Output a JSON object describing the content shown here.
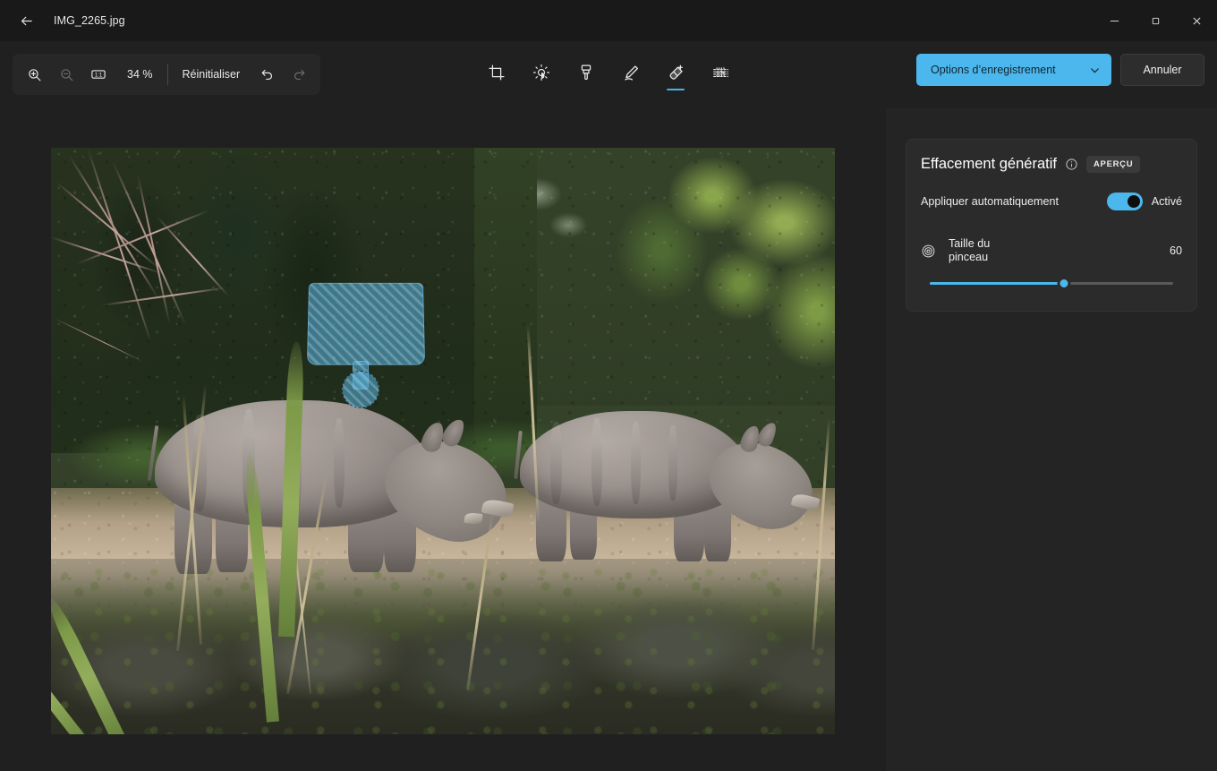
{
  "window": {
    "title": "IMG_2265.jpg",
    "back_icon": "arrow-left-icon",
    "minimize_icon": "minimize-icon",
    "maximize_icon": "maximize-icon",
    "close_icon": "close-icon"
  },
  "toolbar": {
    "zoom_in_icon": "zoom-in-icon",
    "zoom_out_icon": "zoom-out-icon",
    "actual_size_icon": "one-to-one-icon",
    "zoom_level": "34 %",
    "reset_label": "Réinitialiser",
    "undo_icon": "undo-icon",
    "redo_icon": "redo-icon",
    "tools": [
      {
        "name": "crop-tool",
        "icon": "crop-icon",
        "active": false
      },
      {
        "name": "adjustment-tool",
        "icon": "brightness-icon",
        "active": false
      },
      {
        "name": "filter-tool",
        "icon": "paintbrush-icon",
        "active": false
      },
      {
        "name": "markup-tool",
        "icon": "pen-icon",
        "active": false
      },
      {
        "name": "erase-tool",
        "icon": "erase-icon",
        "active": true
      },
      {
        "name": "background-tool",
        "icon": "background-blur-icon",
        "active": false
      }
    ],
    "save_options_label": "Options d’enregistrement",
    "save_options_chevron": "chevron-down-icon",
    "cancel_label": "Annuler"
  },
  "panel": {
    "title": "Effacement génératif",
    "info_icon": "info-icon",
    "preview_badge": "APERÇU",
    "auto_apply_label": "Appliquer automatiquement",
    "auto_apply_state": "Activé",
    "auto_apply_on": true,
    "brush_icon": "brush-size-target-icon",
    "brush_label_line1": "Taille du",
    "brush_label_line2": "pinceau",
    "brush_value": "60",
    "brush_slider_percent": 55
  },
  "canvas": {
    "image_name": "IMG_2265.jpg",
    "description": "Photo de deux rhinocéros blancs broutant dans un enclos de zoo",
    "mask_label": "selection-mask",
    "cursor_label": "brush-cursor"
  },
  "colors": {
    "accent": "#4cb7ec",
    "titlebar_bg": "#191919",
    "app_bg": "#202020",
    "sidebar_bg": "#242424",
    "card_bg": "#2b2b2b",
    "mask_blue": "#4fa6d1"
  }
}
